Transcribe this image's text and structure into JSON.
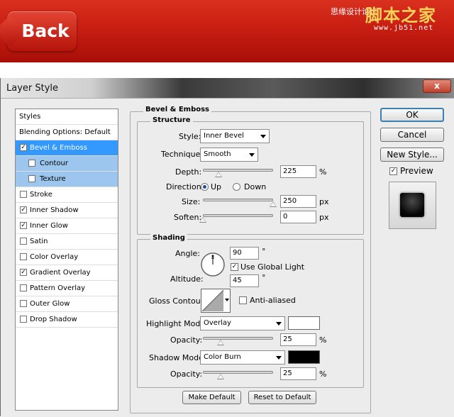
{
  "banner": {
    "back_label": "Back",
    "watermark_small": "思缘设计论坛",
    "watermark_big": "脚本之家",
    "watermark_url": "www.jb51.net"
  },
  "window": {
    "title": "Layer Style",
    "close_label": "x"
  },
  "styles_list": {
    "header": "Styles",
    "blending": "Blending Options: Default",
    "items": [
      {
        "label": "Bevel & Emboss",
        "checked": true,
        "state": "selected"
      },
      {
        "label": "Contour",
        "checked": false,
        "state": "sub"
      },
      {
        "label": "Texture",
        "checked": false,
        "state": "sub"
      },
      {
        "label": "Stroke",
        "checked": false,
        "state": "normal"
      },
      {
        "label": "Inner Shadow",
        "checked": true,
        "state": "normal"
      },
      {
        "label": "Inner Glow",
        "checked": true,
        "state": "normal"
      },
      {
        "label": "Satin",
        "checked": false,
        "state": "normal"
      },
      {
        "label": "Color Overlay",
        "checked": false,
        "state": "normal"
      },
      {
        "label": "Gradient Overlay",
        "checked": true,
        "state": "normal"
      },
      {
        "label": "Pattern Overlay",
        "checked": false,
        "state": "normal"
      },
      {
        "label": "Outer Glow",
        "checked": false,
        "state": "normal"
      },
      {
        "label": "Drop Shadow",
        "checked": false,
        "state": "normal"
      }
    ]
  },
  "bevel": {
    "group_title": "Bevel & Emboss",
    "structure_title": "Structure",
    "style_label": "Style:",
    "style_value": "Inner Bevel",
    "technique_label": "Technique:",
    "technique_value": "Smooth",
    "depth_label": "Depth:",
    "depth_value": "225",
    "depth_unit": "%",
    "direction_label": "Direction:",
    "dir_up": "Up",
    "dir_down": "Down",
    "size_label": "Size:",
    "size_value": "250",
    "size_unit": "px",
    "soften_label": "Soften:",
    "soften_value": "0",
    "soften_unit": "px",
    "shading_title": "Shading",
    "angle_label": "Angle:",
    "angle_value": "90",
    "degree": "°",
    "global_light_label": "Use Global Light",
    "altitude_label": "Altitude:",
    "altitude_value": "45",
    "gloss_label": "Gloss Contour:",
    "anti_aliased_label": "Anti-aliased",
    "highlight_mode_label": "Highlight Mode:",
    "highlight_mode_value": "Overlay",
    "highlight_color": "#ffffff",
    "highlight_opacity_label": "Opacity:",
    "highlight_opacity_value": "25",
    "shadow_mode_label": "Shadow Mode:",
    "shadow_mode_value": "Color Burn",
    "shadow_color": "#000000",
    "shadow_opacity_label": "Opacity:",
    "shadow_opacity_value": "25",
    "pct": "%",
    "make_default": "Make Default",
    "reset_default": "Reset to Default"
  },
  "right": {
    "ok": "OK",
    "cancel": "Cancel",
    "new_style": "New Style...",
    "preview_label": "Preview"
  }
}
